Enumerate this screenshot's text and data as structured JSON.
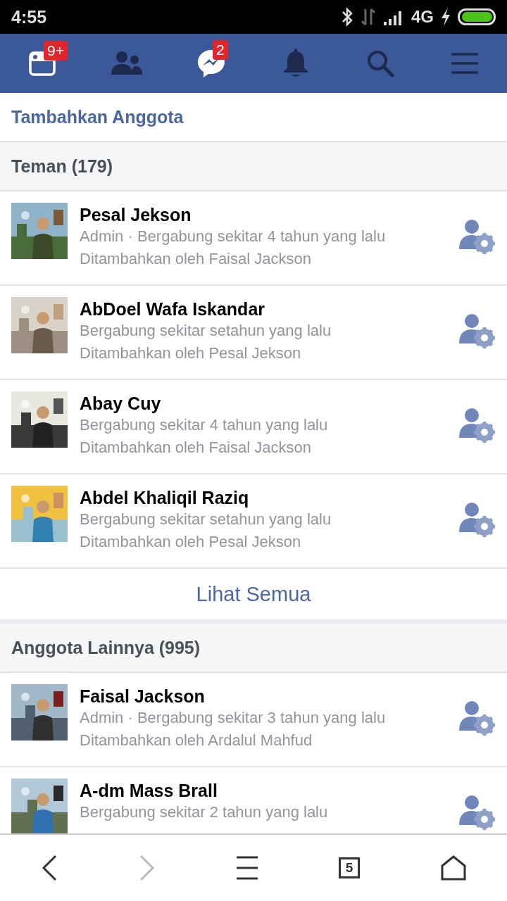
{
  "status_bar": {
    "time": "4:55",
    "network": "4G"
  },
  "nav": [
    {
      "kind": "feed",
      "badge": "9+"
    },
    {
      "kind": "friends"
    },
    {
      "kind": "messenger",
      "badge": "2"
    },
    {
      "kind": "bell"
    },
    {
      "kind": "search"
    },
    {
      "kind": "menu"
    }
  ],
  "add_member": "Tambahkan Anggota",
  "sections": [
    {
      "title": "Teman (179)",
      "see_all": "Lihat Semua",
      "members": [
        {
          "name": "Pesal Jekson",
          "lines": [
            "Admin · Bergabung sekitar 4 tahun yang lalu",
            "Ditambahkan oleh Faisal Jackson"
          ]
        },
        {
          "name": "AbDoel Wafa Iskandar",
          "lines": [
            "Bergabung sekitar setahun yang lalu",
            "Ditambahkan oleh Pesal Jekson"
          ]
        },
        {
          "name": "Abay Cuy",
          "lines": [
            "Bergabung sekitar 4 tahun yang lalu",
            "Ditambahkan oleh Faisal Jackson"
          ]
        },
        {
          "name": "Abdel Khaliqil Raziq",
          "lines": [
            "Bergabung sekitar setahun yang lalu",
            "Ditambahkan oleh Pesal Jekson"
          ]
        }
      ]
    },
    {
      "title": "Anggota Lainnya (995)",
      "members": [
        {
          "name": "Faisal Jackson",
          "lines": [
            "Admin · Bergabung sekitar 3 tahun yang lalu",
            "Ditambahkan oleh Ardalul Mahfud"
          ]
        },
        {
          "name": "A-dm Mass Brall",
          "lines": [
            "Bergabung sekitar 2 tahun yang lalu"
          ]
        }
      ]
    }
  ],
  "browser_bar": {
    "tabs_count": "5"
  }
}
